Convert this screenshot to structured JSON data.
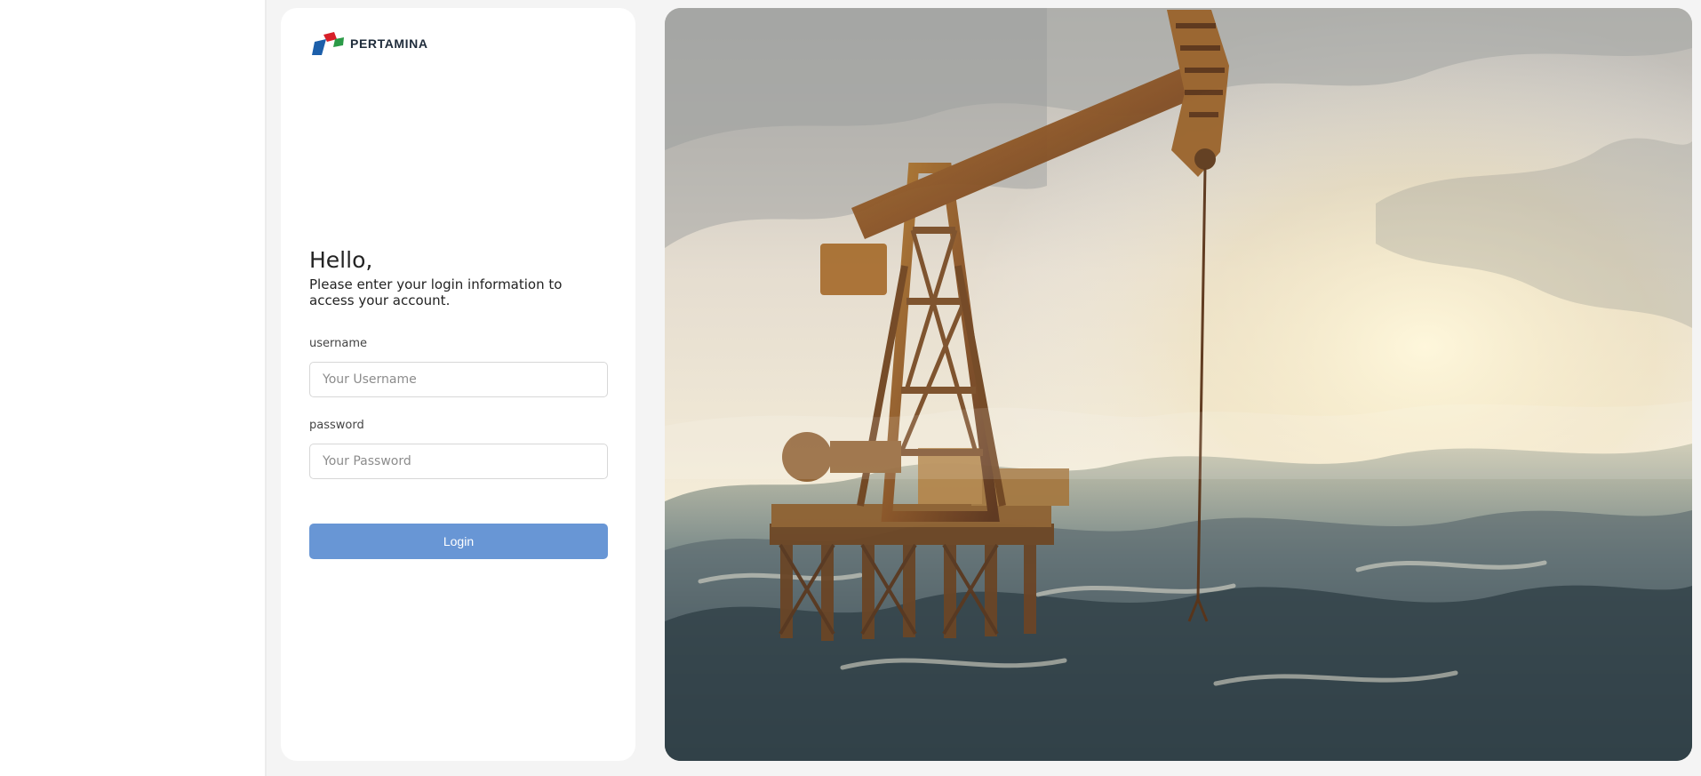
{
  "brand": {
    "name": "PERTAMINA",
    "colors": [
      "#d71f28",
      "#2b9a47",
      "#1c5faa"
    ]
  },
  "greeting": {
    "title": "Hello,",
    "subtitle": "Please enter your login information to access your account."
  },
  "form": {
    "username": {
      "label": "username",
      "placeholder": "Your Username",
      "value": ""
    },
    "password": {
      "label": "password",
      "placeholder": "Your Password",
      "value": ""
    },
    "login_label": "Login"
  },
  "colors": {
    "accent": "#6896d5",
    "background": "#f4f4f4",
    "card": "#ffffff"
  },
  "hero": {
    "subject": "oil-pumpjack-rig-in-sea",
    "icon": "decorative-hero-image"
  }
}
